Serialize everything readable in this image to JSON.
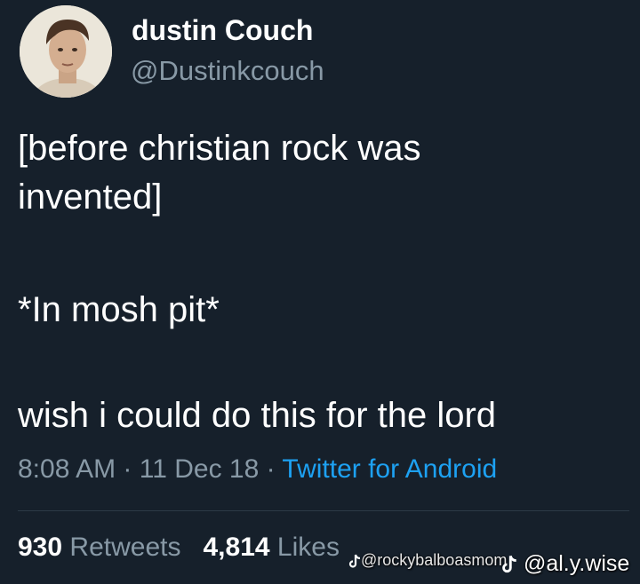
{
  "tweet": {
    "author_name": "dustin Couch",
    "author_handle": "@Dustinkcouch",
    "lines": [
      "[before christian rock was",
      "invented]",
      "*In mosh pit*",
      "wish i could do this for the lord"
    ],
    "time": "8:08 AM",
    "separator": " · ",
    "date": "11 Dec 18",
    "source": "Twitter for Android",
    "retweet_count": "930",
    "retweet_label": "Retweets",
    "like_count": "4,814",
    "like_label": "Likes"
  },
  "watermarks": {
    "first_handle": "@rockybalboasmom",
    "second_handle": "@al.y.wise",
    "icon": "tiktok-icon"
  },
  "colors": {
    "background": "#16202b",
    "text": "#ffffff",
    "muted": "#8899a6",
    "link": "#1da1f2"
  }
}
